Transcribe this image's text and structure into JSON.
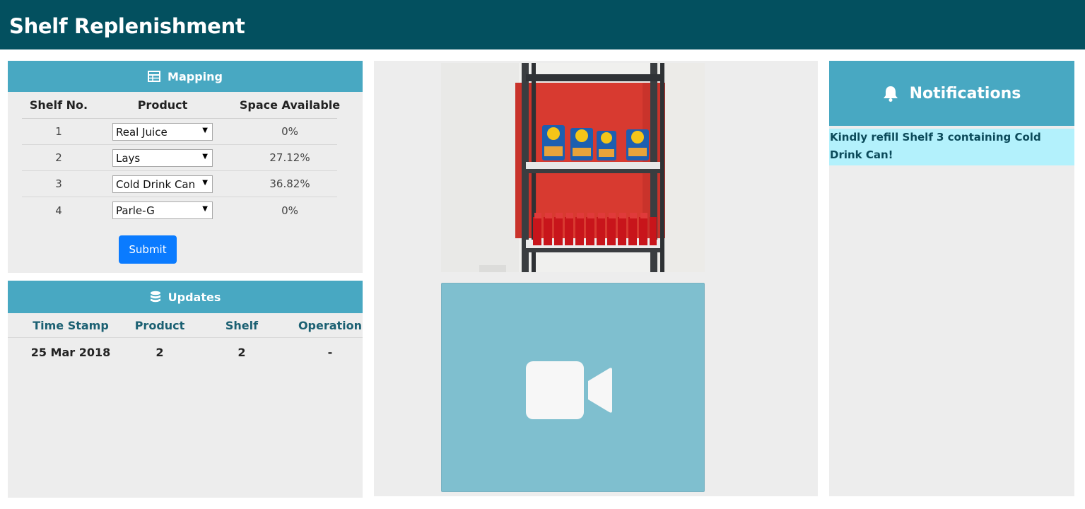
{
  "header": {
    "title": "Shelf Replenishment"
  },
  "mapping": {
    "title": "Mapping",
    "icon": "table-icon",
    "columns": [
      "Shelf No.",
      "Product",
      "Space Available"
    ],
    "rows": [
      {
        "shelf": "1",
        "product": "Real Juice",
        "space": "0%"
      },
      {
        "shelf": "2",
        "product": "Lays",
        "space": "27.12%"
      },
      {
        "shelf": "3",
        "product": "Cold Drink Can",
        "space": "36.82%"
      },
      {
        "shelf": "4",
        "product": "Parle-G",
        "space": "0%"
      }
    ],
    "submit_label": "Submit",
    "submit_color": "#0a7bff"
  },
  "updates": {
    "title": "Updates",
    "icon": "database-icon",
    "columns": [
      "Time Stamp",
      "Product",
      "Shelf",
      "Operation"
    ],
    "rows": [
      {
        "timestamp": "25 Mar 2018",
        "product": "2",
        "shelf": "2",
        "operation": "-"
      }
    ]
  },
  "camera": {
    "icon": "video-camera-icon"
  },
  "notifications": {
    "title": "Notifications",
    "icon": "bell-icon",
    "items": [
      {
        "text": "Kindly refill Shelf 3 containing Cold Drink Can!"
      }
    ]
  },
  "colors": {
    "header_bg": "#03505f",
    "panel_head_bg": "#48a8c2",
    "notification_bg": "#b3f1fc",
    "video_bg": "#7fbfcf"
  }
}
